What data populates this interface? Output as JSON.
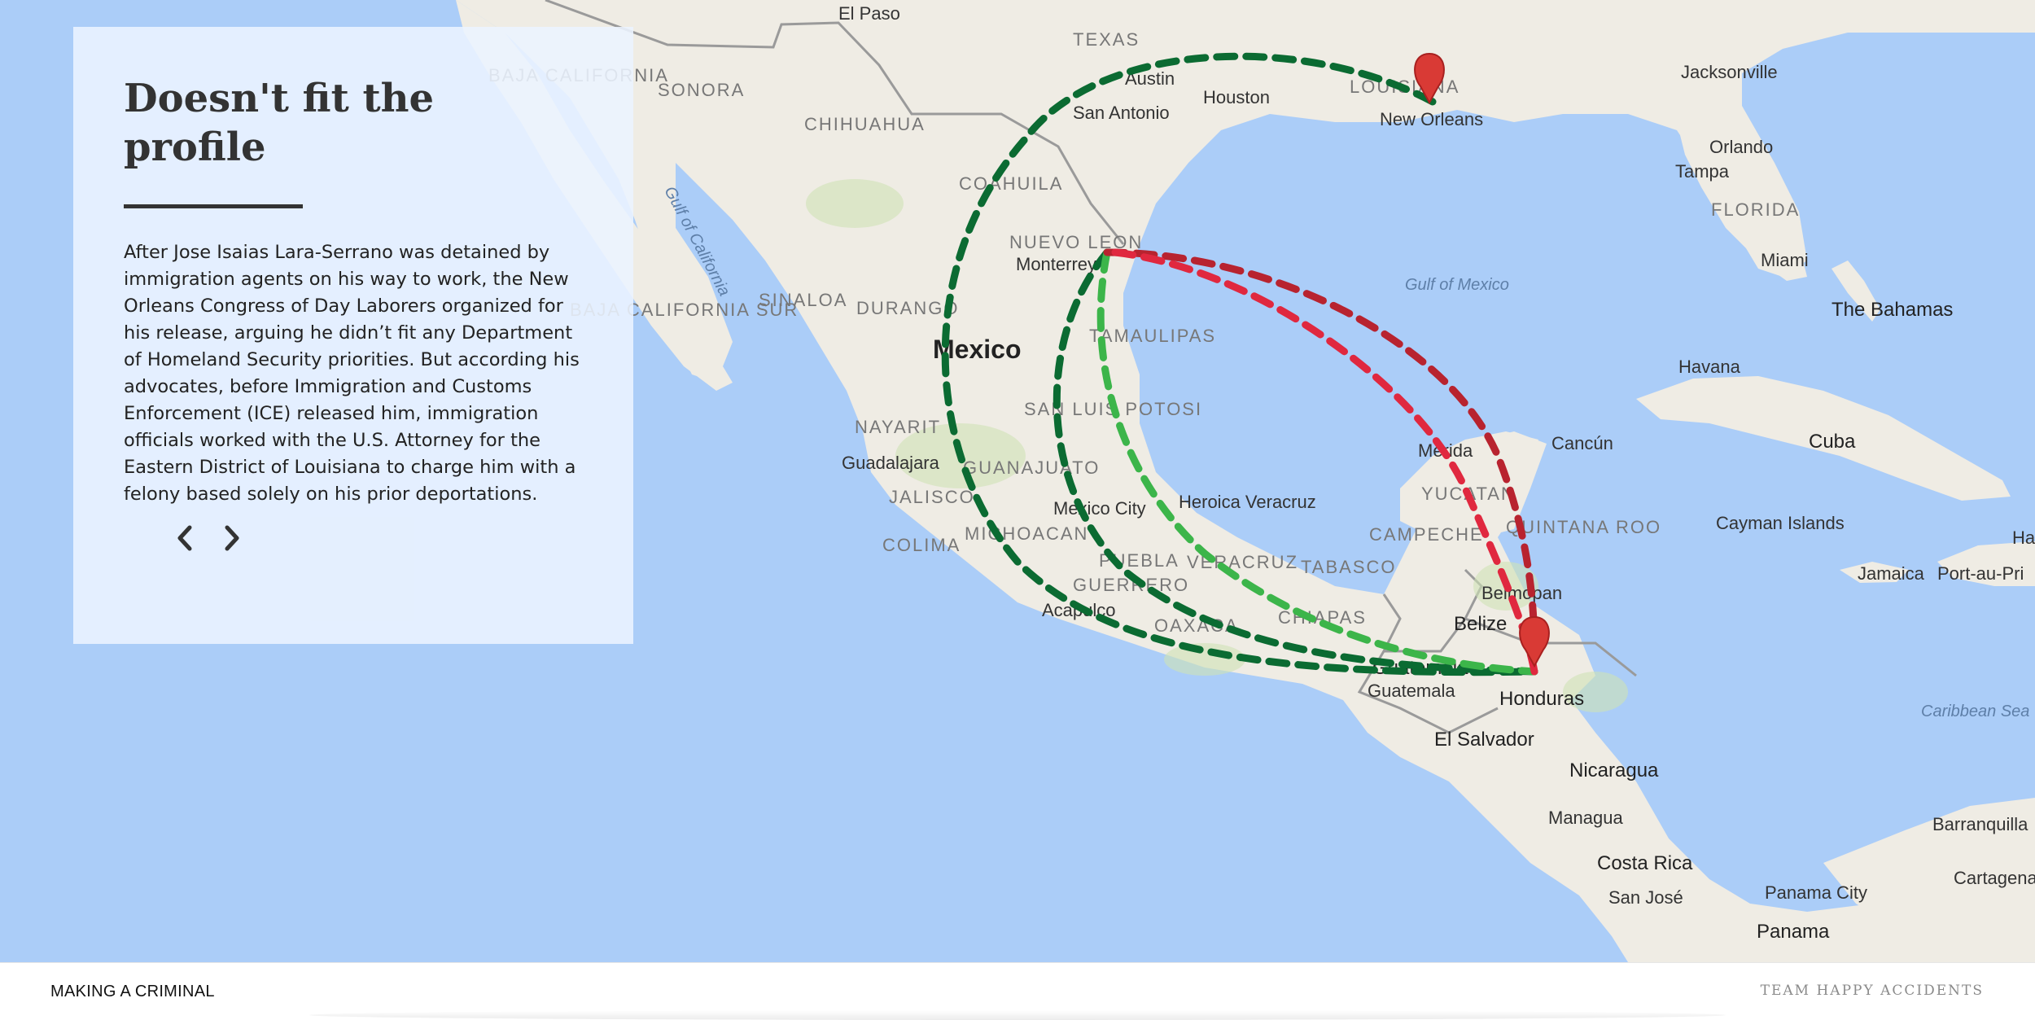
{
  "story": {
    "title": "Doesn't fit the profile",
    "body": "After Jose Isaias Lara-Serrano was detained by immigration agents on his way to work, the New Orleans Congress of Day Laborers organized for his release, arguing he didn’t fit any Department of Homeland Security priorities. But according his advocates, before Immigration and Customs Enforcement (ICE) released him, immigration officials worked with the U.S. Attorney for the Eastern District of Louisiana to charge him with a felony based solely on his prior deportations.",
    "prev_icon": "chevron-left-icon",
    "next_icon": "chevron-right-icon"
  },
  "footer": {
    "site_title": "MAKING A CRIMINAL",
    "team": "TEAM HAPPY ACCIDENTS"
  },
  "map": {
    "labels": {
      "el_paso": "El Paso",
      "texas": "TEXAS",
      "austin": "Austin",
      "houston": "Houston",
      "san_antonio": "San Antonio",
      "louisiana": "LOUISIANA",
      "new_orleans": "New Orleans",
      "jacksonville": "Jacksonville",
      "orlando": "Orlando",
      "tampa": "Tampa",
      "florida": "FLORIDA",
      "miami": "Miami",
      "baja_california": "BAJA CALIFORNIA",
      "sonora": "SONORA",
      "chihuahua": "CHIHUAHUA",
      "coahuila": "COAHUILA",
      "gulf_of_california": "Gulf of California",
      "baja_california_sur": "BAJA CALIFORNIA SUR",
      "sinaloa": "SINALOA",
      "durango": "DURANGO",
      "nuevo_leon": "NUEVO LEON",
      "monterrey": "Monterrey",
      "tamaulipas": "TAMAULIPAS",
      "mexico": "Mexico",
      "gulf_of_mexico": "Gulf of Mexico",
      "the_bahamas": "The Bahamas",
      "havana": "Havana",
      "cuba": "Cuba",
      "nayarit": "NAYARIT",
      "san_luis_potosi": "SAN LUIS POTOSI",
      "guadalajara": "Guadalajara",
      "guanajuato": "GUANAJUATO",
      "jalisco": "JALISCO",
      "merida": "Mérida",
      "cancun": "Cancún",
      "yucatan": "YUCATAN",
      "mexico_city": "Mexico City",
      "heroica_veracruz": "Heroica Veracruz",
      "michoacan": "MICHOACAN",
      "colima": "COLIMA",
      "campeche": "CAMPECHE",
      "quintana_roo": "QUINTANA ROO",
      "cayman_islands": "Cayman Islands",
      "puebla": "PUEBLA",
      "veracruz": "VERACRUZ",
      "tabasco": "TABASCO",
      "guerrero": "GUERRERO",
      "acapulco": "Acapulco",
      "belmopan": "Belmopan",
      "jamaica": "Jamaica",
      "port_au_prince": "Port-au-Pri",
      "ha": "Ha",
      "oaxaca": "OAXACA",
      "chiapas": "CHIAPAS",
      "belize": "Belize",
      "guatemala_country": "Guatemala",
      "guatemala_city": "Guatemala",
      "honduras": "Honduras",
      "caribbean_sea": "Caribbean Sea",
      "el_salvador": "El Salvador",
      "nicaragua": "Nicaragua",
      "managua": "Managua",
      "barranquilla": "Barranquilla",
      "cartagena": "Cartagena",
      "costa_rica": "Costa Rica",
      "san_jose": "San José",
      "panama_city": "Panama City",
      "panama": "Panama"
    },
    "colors": {
      "ocean": "#abcdf8",
      "land": "#f0ede5",
      "route_dark_green": "#0b6b32",
      "route_light_green": "#3cb54a",
      "route_red": "#d9283a",
      "route_dark_red": "#b8232f",
      "marker": "#d93a35"
    },
    "markers": [
      "new-orleans-marker",
      "honduras-marker"
    ]
  }
}
